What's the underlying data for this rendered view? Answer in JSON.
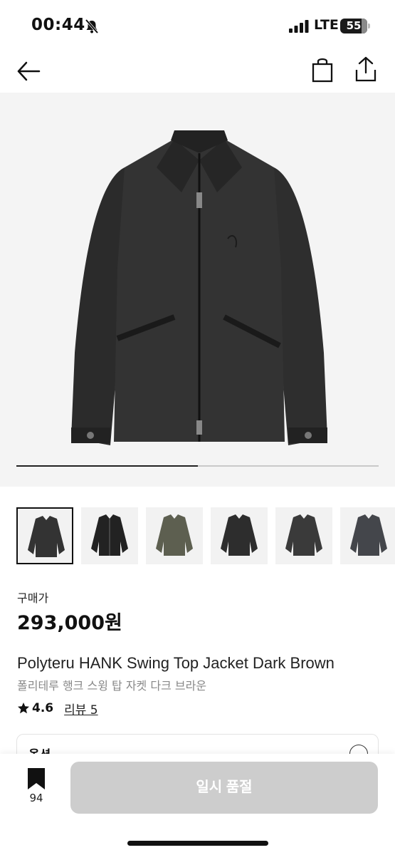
{
  "status_bar": {
    "time": "00:44",
    "network": "LTE",
    "battery_level": "55",
    "icons": [
      "mute-icon",
      "signal-icon",
      "battery-icon"
    ]
  },
  "nav": {
    "icons": [
      "back-arrow-icon",
      "shopping-bag-icon",
      "share-icon"
    ]
  },
  "gallery": {
    "progress_fraction": 0.5,
    "thumbnail_count": 6,
    "selected_index": 0
  },
  "product": {
    "price_label": "구매가",
    "price": "293,000원",
    "title_en": "Polyteru HANK Swing Top Jacket Dark Brown",
    "title_ko": "폴리테루 행크 스윙 탑 자켓 다크 브라운",
    "rating": "4.6",
    "review_link": "리뷰 5"
  },
  "option": {
    "label": "옵션"
  },
  "bottom_bar": {
    "bookmark_count": "94",
    "buy_button_label": "일시 품절"
  },
  "colors": {
    "disabled_button": "#cdcdcd",
    "accent": "#111111"
  }
}
